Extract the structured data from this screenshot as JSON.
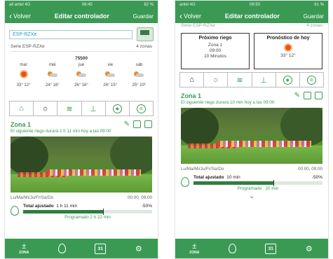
{
  "left": {
    "status": {
      "carrier": "all antel 4G",
      "time": "08:45",
      "battery": "82 %"
    },
    "nav": {
      "back": "Volver",
      "title": "Editar controlador",
      "save": "Guardar"
    },
    "controller_name": "ESP-RZXe",
    "series_label": "Serie ESP-RZXe",
    "zones_count": "4 zonas",
    "zip": "75500",
    "forecast": [
      {
        "day": "mar",
        "icon": "sun-icon",
        "temp": "33° 12°"
      },
      {
        "day": "mié",
        "icon": "partly-cloudy-icon",
        "temp": "24° 16°"
      },
      {
        "day": "jue",
        "icon": "partly-cloudy-icon",
        "temp": "26° 16°"
      },
      {
        "day": "vie",
        "icon": "partly-cloudy-icon",
        "temp": "26° 15°"
      },
      {
        "day": "sáb",
        "icon": "partly-cloudy-icon",
        "temp": "25° 10°"
      }
    ],
    "zone": {
      "title": "Zona 1",
      "subtitle": "El siguiente riego durará 1 h 11 min hoy a las 09:00",
      "days": "Lu/Ma/Mi/Ju/Fr/Sa/Do",
      "times": "00:00, 09:00",
      "budget_label": "Total ajustado",
      "budget_value": "1 h 11 min",
      "budget_percent": "-50%",
      "bar_fill": 0.62,
      "programmed": "Programado 2 h 22 min"
    }
  },
  "right": {
    "status": {
      "carrier": "antel 4G",
      "time": "08:50",
      "battery": "81 %"
    },
    "nav": {
      "back": "Volver",
      "title": "Editar controlador",
      "save": "Guardar"
    },
    "ghost_left": "Serie ESP-RZXe",
    "ghost_right": "4 zonas",
    "next_card": {
      "title": "Próximo riego",
      "zone": "Zona 1",
      "time": "09:00",
      "duration": "10 Minutos"
    },
    "forecast_card": {
      "title": "Pronóstico de hoy",
      "temp": "33° 12°"
    },
    "zone": {
      "title": "Zona 1",
      "subtitle": "El siguiente riego durará 10 min hoy a las 09:00",
      "days": "Lu/Ma/Mi/Ju/Fr/Sa/Do",
      "times": "00:00, 09:00",
      "budget_label": "Total ajustado",
      "budget_value": "10 min",
      "budget_percent": "-50%",
      "bar_fill": 0.62,
      "programmed": "Programado",
      "programmed_value": "20 min"
    }
  },
  "bottom_nav": {
    "zone_label": "ZONA",
    "calendar_day": "31"
  },
  "colors": {
    "primary": "#3a9a54",
    "bar": "#2e7f3e"
  }
}
